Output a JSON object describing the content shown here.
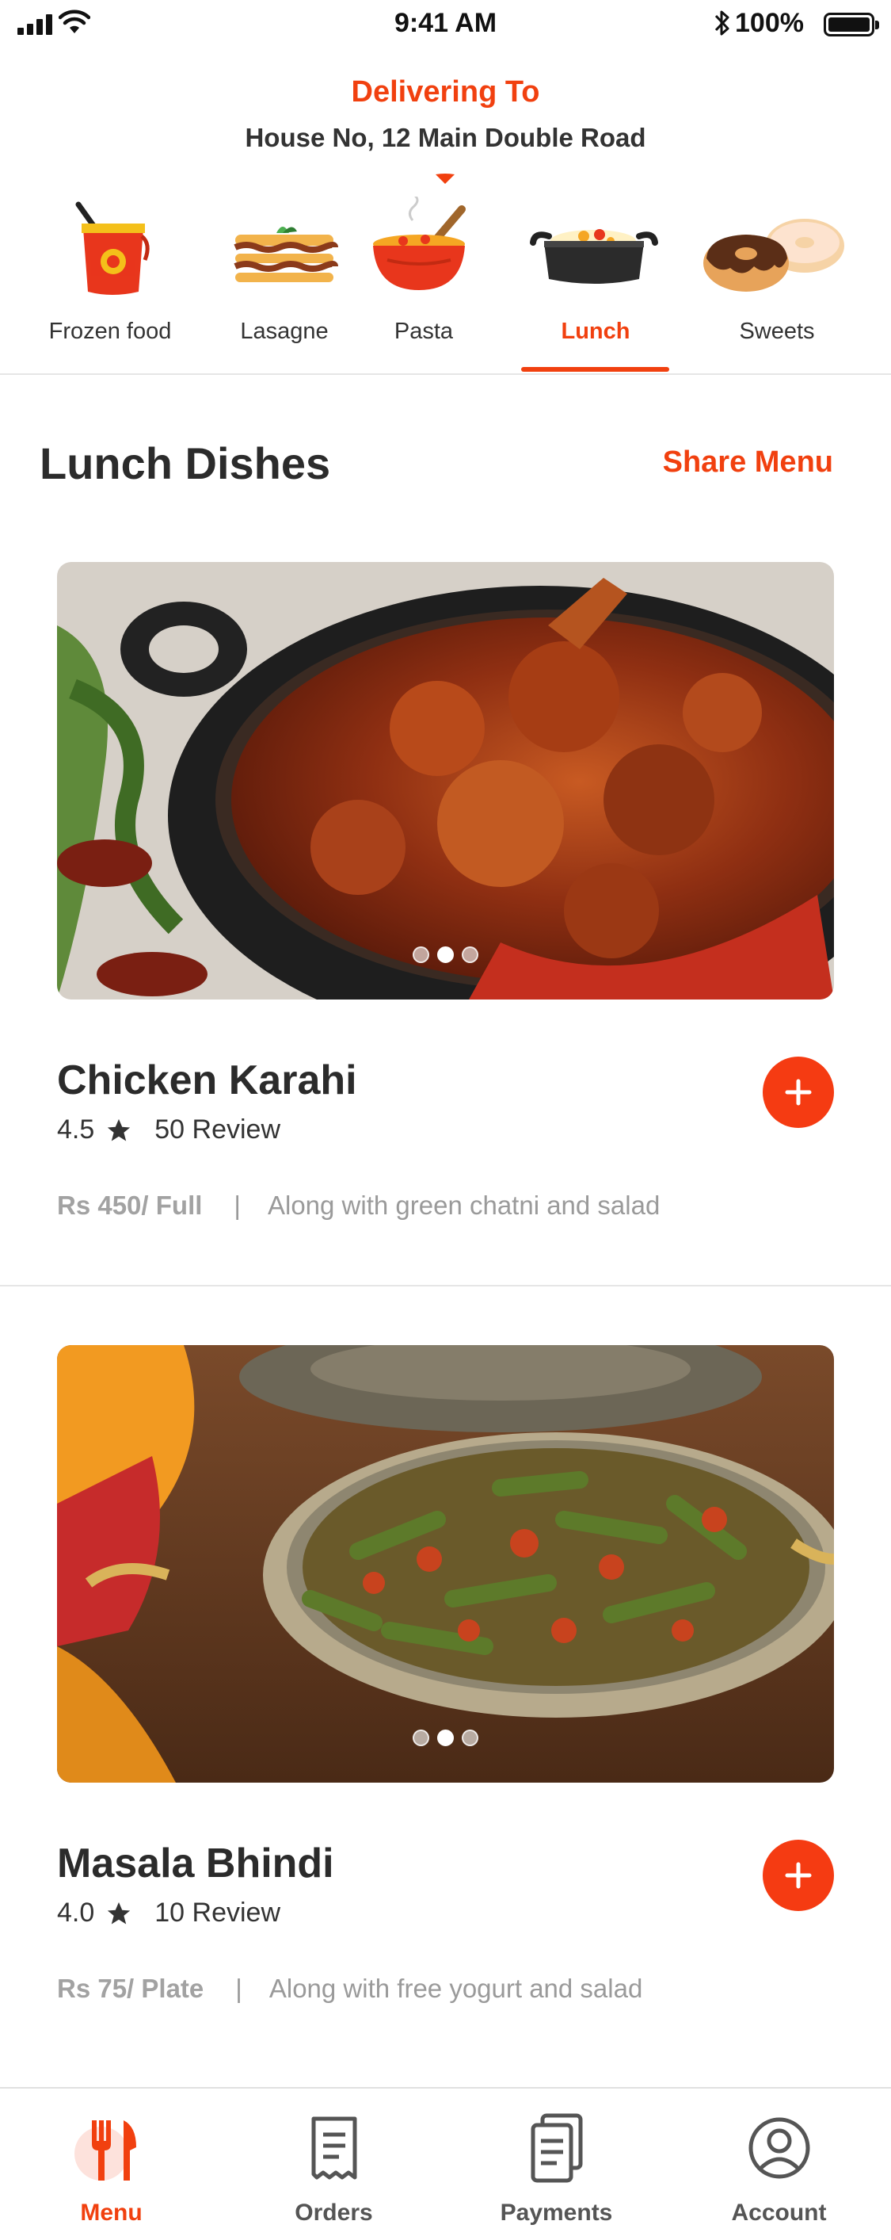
{
  "status_bar": {
    "time": "9:41 AM",
    "battery": "100%"
  },
  "header": {
    "delivering_label": "Delivering To",
    "address": "House No, 12 Main Double Road"
  },
  "categories": [
    {
      "label": "Frozen food",
      "icon": "frozen-food-icon"
    },
    {
      "label": "Lasagne",
      "icon": "lasagne-icon"
    },
    {
      "label": "Pasta",
      "icon": "pasta-icon"
    },
    {
      "label": "Lunch",
      "icon": "lunch-pan-icon",
      "active": true
    },
    {
      "label": "Sweets",
      "icon": "donut-icon"
    }
  ],
  "section": {
    "title": "Lunch Dishes",
    "share_label": "Share Menu"
  },
  "dishes": [
    {
      "name": "Chicken Karahi",
      "rating": "4.5",
      "reviews": "50 Review",
      "price": "Rs 450/ Full",
      "note": "Along with green chatni and salad",
      "image": "chicken-karahi-photo",
      "active_slide": 1
    },
    {
      "name": "Masala Bhindi",
      "rating": "4.0",
      "reviews": "10 Review",
      "price": "Rs 75/ Plate",
      "note": "Along with free yogurt and salad",
      "image": "masala-bhindi-photo",
      "active_slide": 2
    }
  ],
  "bottom_nav": [
    {
      "label": "Menu",
      "icon": "fork-knife-icon",
      "active": true
    },
    {
      "label": "Orders",
      "icon": "receipt-icon"
    },
    {
      "label": "Payments",
      "icon": "payments-icon"
    },
    {
      "label": "Account",
      "icon": "account-icon"
    }
  ],
  "colors": {
    "accent": "#f1400f",
    "text": "#2b2b2b",
    "muted": "#9a9a9a",
    "divider": "#e6e6e6"
  }
}
